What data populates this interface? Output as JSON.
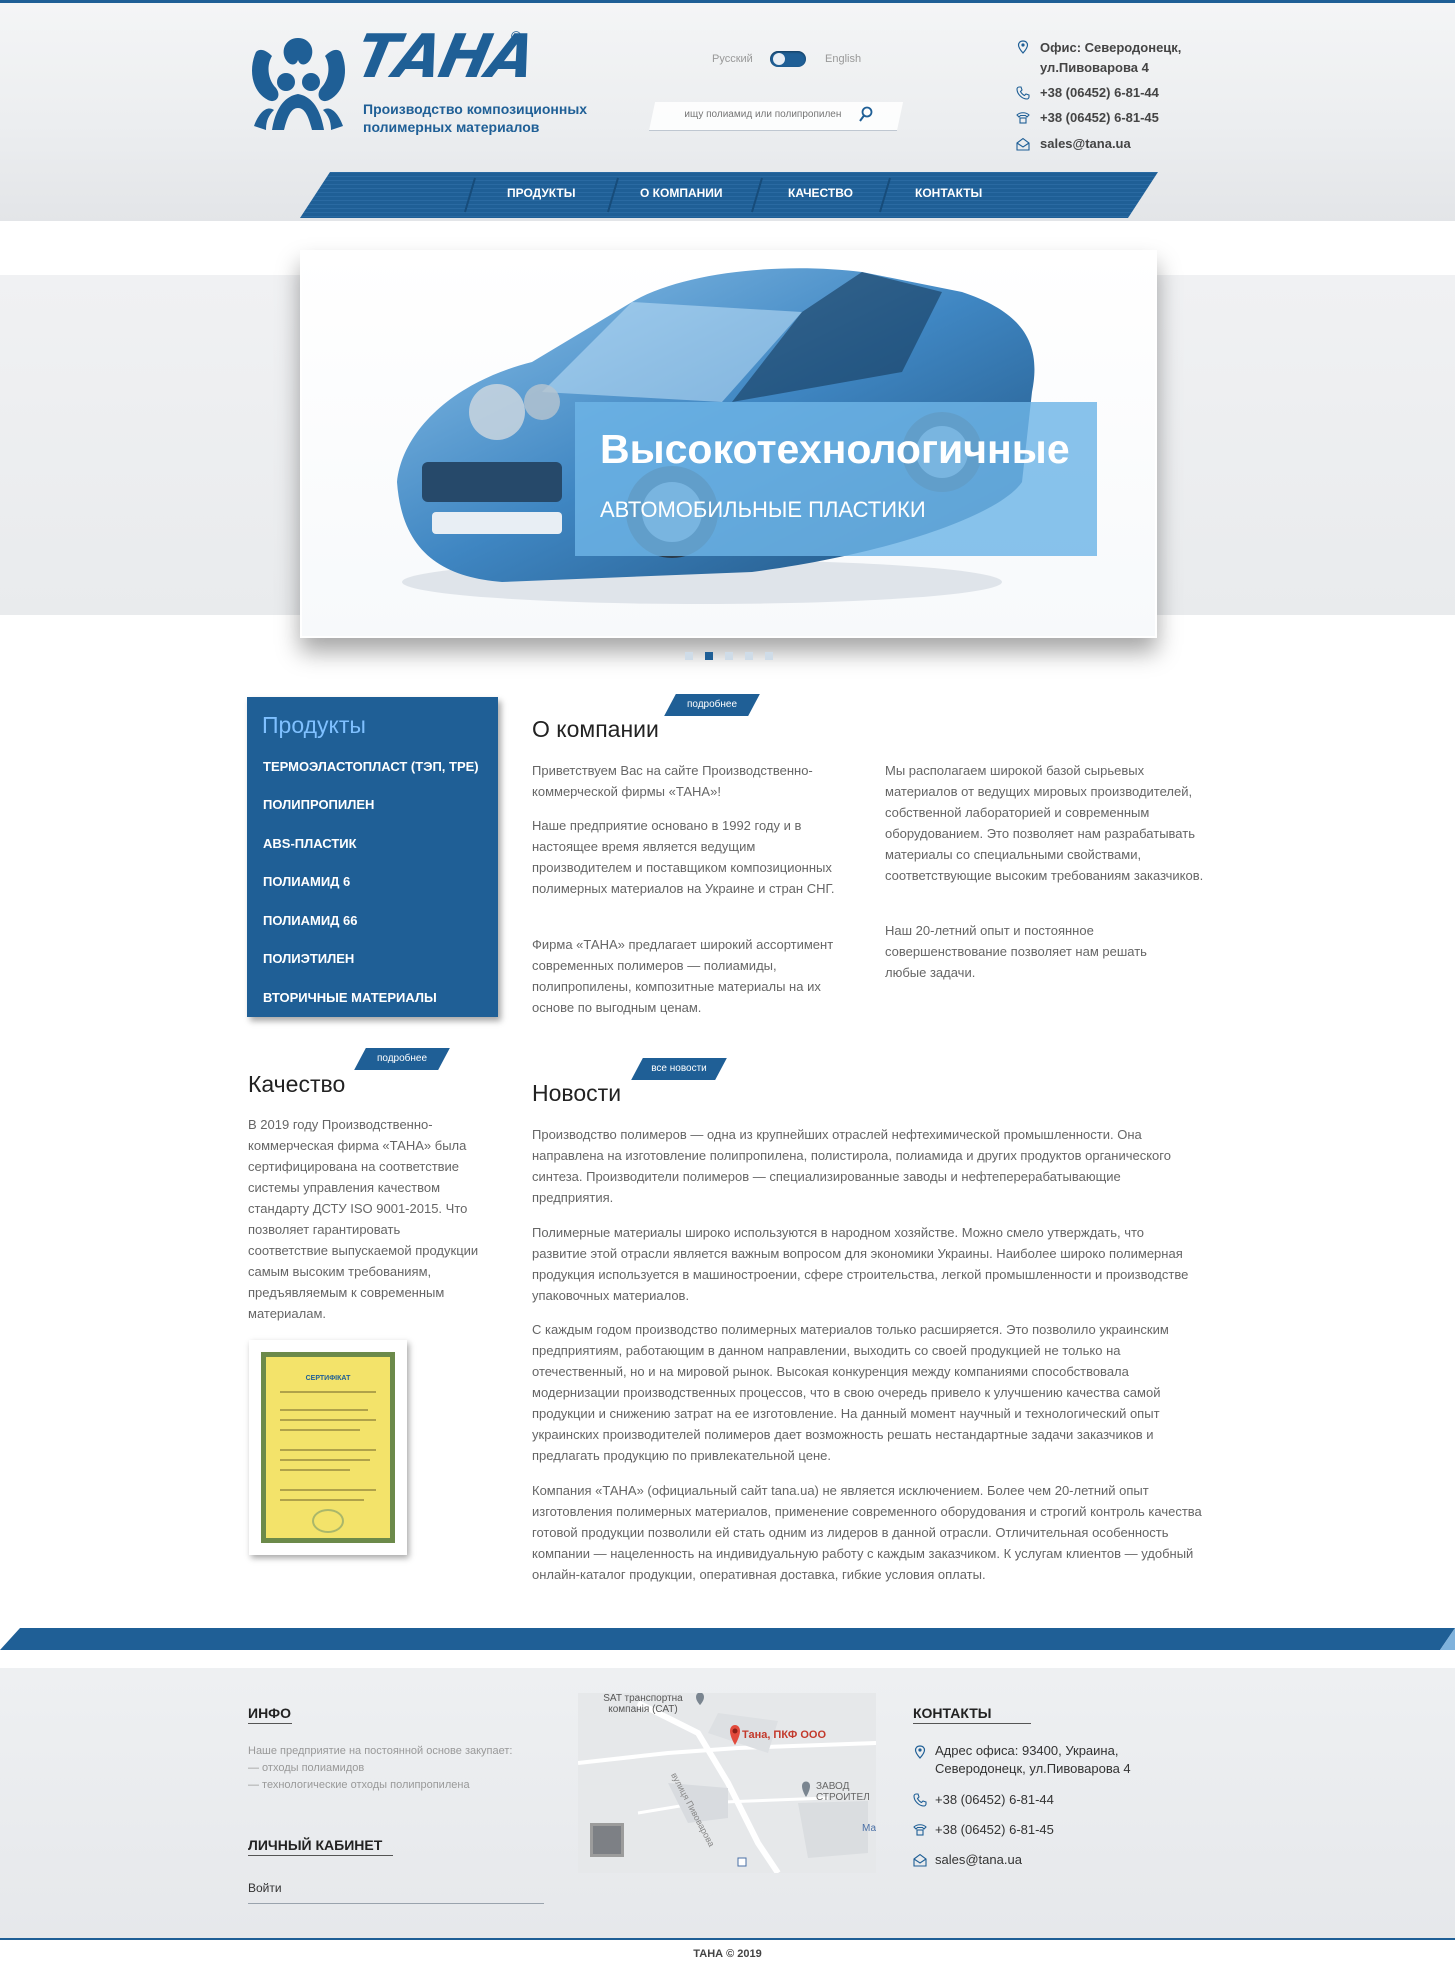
{
  "header": {
    "brand": "ТАНА",
    "registered": "®",
    "tagline": "Производство композиционных полимерных материалов",
    "lang": {
      "ru": "Русский",
      "en": "English"
    },
    "search": {
      "placeholder": "ищу полиамид или полипропилен",
      "value": ""
    },
    "contacts": {
      "office": "Офис: Северодонецк, ул.Пивоварова 4",
      "phone1": "+38 (06452) 6-81-44",
      "phone2": "+38 (06452) 6-81-45",
      "email": "sales@tana.ua"
    }
  },
  "nav": [
    "ПРОДУКТЫ",
    "О КОМПАНИИ",
    "КАЧЕСТВО",
    "КОНТАКТЫ"
  ],
  "hero": {
    "title": "Высокотехнологичные",
    "subtitle": "АВТОМОБИЛЬНЫЕ ПЛАСТИКИ",
    "slides": 5,
    "active_slide": 2
  },
  "products": {
    "title": "Продукты",
    "items": [
      "ТЕРМОЭЛАСТОПЛАСТ (ТЭП, TPE)",
      "ПОЛИПРОПИЛЕН",
      "ABS-ПЛАСТИК",
      "ПОЛИАМИД 6",
      "ПОЛИАМИД 66",
      "ПОЛИЭТИЛЕН",
      "ВТОРИЧНЫЕ МАТЕРИАЛЫ"
    ]
  },
  "about": {
    "tag": "подробнее",
    "title": "О компании",
    "col1": [
      "Приветствуем Вас на сайте Производственно-коммерческой фирмы «ТАНА»!",
      "Наше предприятие основано в 1992 году и в настоящее время является ведущим производителем и поставщиком композиционных полимерных материалов на Украине и стран СНГ.",
      "Фирма «ТАНА» предлагает широкий ассортимент современных полимеров — полиамиды, полипропилены, композитные материалы на их основе по выгодным ценам."
    ],
    "col2": [
      "Мы располагаем широкой базой сырьевых материалов от ведущих мировых производителей, собственной лабораторией и современным оборудованием. Это позволяет нам разрабатывать материалы со специальными свойствами, соответствующие высоким требованиям заказчиков.",
      "Наш 20-летний опыт и постоянное совершенствование позволяет нам решать любые задачи."
    ]
  },
  "quality": {
    "tag": "подробнее",
    "title": "Качество",
    "text": "В 2019 году Производственно-коммерческая фирма «ТАНА» была сертифицирована на соответствие системы управления качеством стандарту ДСТУ ISO 9001-2015. Что позволяет гарантировать соответствие выпускаемой продукции самым высоким требованиям, предъявляемым к современным материалам.",
    "cert_title": "СЕРТИФІКАТ"
  },
  "news": {
    "tag": "все новости",
    "title": "Новости",
    "paragraphs": [
      "Производство полимеров — одна из крупнейших отраслей нефтехимической промышленности. Она направлена на изготовление полипропилена, полистирола, полиамида и других продуктов органического синтеза. Производители полимеров — специализированные заводы и нефтеперерабатывающие предприятия.",
      "Полимерные материалы широко используются в народном хозяйстве. Можно смело утверждать, что развитие этой отрасли является важным вопросом для экономики Украины. Наиболее широко полимерная продукция используется в машиностроении, сфере строительства, легкой промышленности и производстве упаковочных материалов.",
      "С каждым годом производство полимерных материалов только расширяется. Это позволило украинским предприятиям, работающим в данном направлении, выходить со своей продукцией не только на отечественный, но и на мировой рынок. Высокая конкуренция между компаниями способствовала модернизации производственных процессов, что в свою очередь привело к улучшению качества самой продукции и снижению затрат на ее изготовление. На данный момент научный и технологический опыт украинских производителей полимеров дает возможность решать нестандартные задачи заказчиков и предлагать продукцию по привлекательной цене.",
      "Компания «ТАНА» (официальный сайт tana.ua) не является исключением. Более чем 20-летний опыт изготовления полимерных материалов, применение современного оборудования и строгий контроль качества готовой продукции позволили ей стать одним из лидеров в данной отрасли. Отличительная особенность компании — нацеленность на индивидуальную работу с каждым заказчиком. К услугам клиентов — удобный онлайн-каталог продукции, оперативная доставка, гибкие условия оплаты."
    ]
  },
  "footer": {
    "info_title": "ИНФО",
    "info_lines": [
      "Наше предприятие на постоянной основе закупает:",
      "— отходы полиамидов",
      "— технологические отходы полипропилена"
    ],
    "cabinet_title": "ЛИЧНЫЙ КАБИНЕТ",
    "login": "Войти",
    "map": {
      "poi1": "SAT транспортна компанія (САТ)",
      "pin": "Тана, ПКФ ООО",
      "poi2a": "ЗАВОД",
      "poi2b": "СТРОИТЕЛ",
      "street": "вулиця Пивоварова",
      "ma": "Ма"
    },
    "contacts_title": "КОНТАКТЫ",
    "address": "Адрес офиса: 93400, Украина, Северодонецк, ул.Пивоварова 4",
    "phone1": "+38 (06452) 6-81-44",
    "phone2": "+38 (06452) 6-81-45",
    "email": "sales@tana.ua",
    "copyright": "ТАНА © 2019"
  },
  "colors": {
    "brand": "#1f5f96",
    "accent_light": "#7fc0ff",
    "caption": "#6eb4e6"
  }
}
